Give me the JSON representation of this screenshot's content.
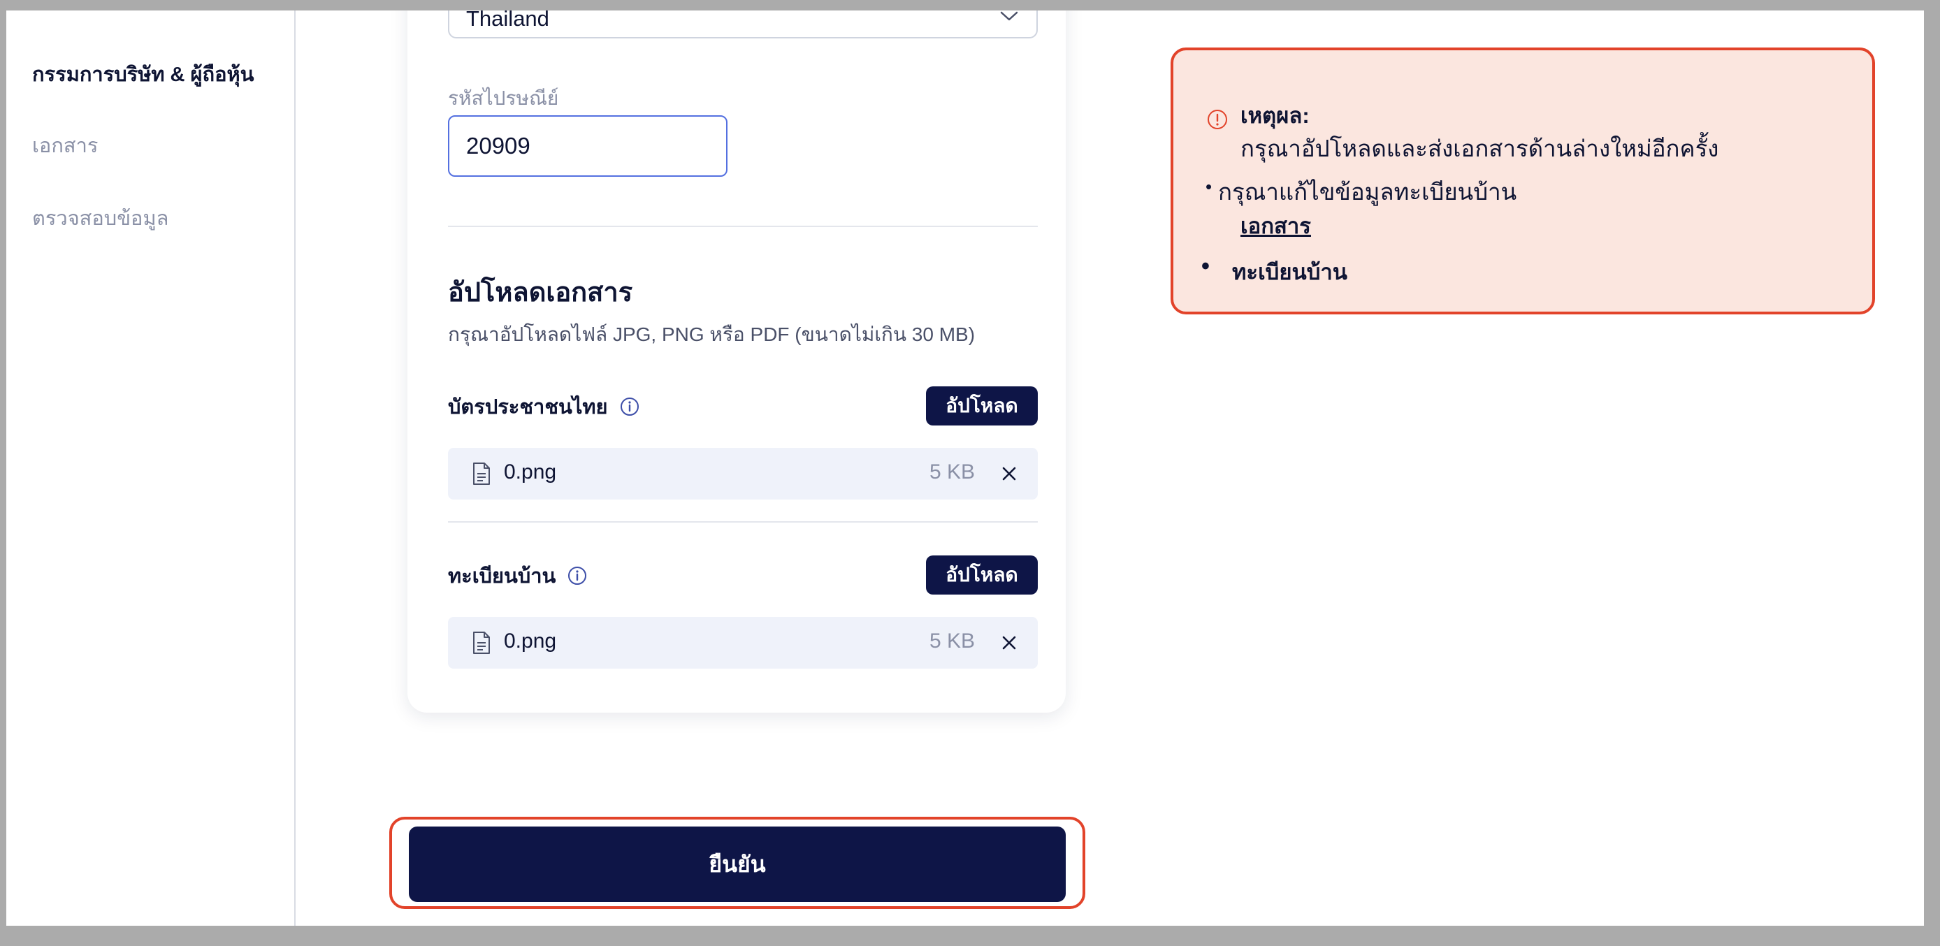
{
  "sidebar": {
    "items": [
      {
        "label": "กรรมการบริษัท & ผู้ถือหุ้น",
        "active": true
      },
      {
        "label": "เอกสาร",
        "active": false
      },
      {
        "label": "ตรวจสอบข้อมูล",
        "active": false
      }
    ]
  },
  "form": {
    "country": {
      "value": "Thailand"
    },
    "postal_code": {
      "label": "รหัสไปรษณีย์",
      "value": "20909"
    }
  },
  "upload": {
    "title": "อัปโหลดเอกสาร",
    "hint": "กรุณาอัปโหลดไฟล์ JPG, PNG หรือ PDF (ขนาดไม่เกิน 30 MB)",
    "documents": [
      {
        "label": "บัตรประชาชนไทย",
        "button": "อัปโหลด",
        "file": {
          "name": "0.png",
          "size": "5 KB"
        }
      },
      {
        "label": "ทะเบียนบ้าน",
        "button": "อัปโหลด",
        "file": {
          "name": "0.png",
          "size": "5 KB"
        }
      }
    ]
  },
  "submit": {
    "label": "ยืนยัน"
  },
  "alert": {
    "title": "เหตุผล:",
    "message": "กรุณาอัปโหลดและส่งเอกสารด้านล่างใหม่อีกครั้ง",
    "item": "กรุณาแก้ไขข้อมูลทะเบียนบ้าน",
    "link": "เอกสาร",
    "document": "ทะเบียนบ้าน"
  },
  "colors": {
    "primary": "#0e1547",
    "error": "#e2432a",
    "error_bg": "#fbe6df",
    "muted": "#8a90a6",
    "input_focus": "#5470e0",
    "file_row_bg": "#eff2fa"
  }
}
